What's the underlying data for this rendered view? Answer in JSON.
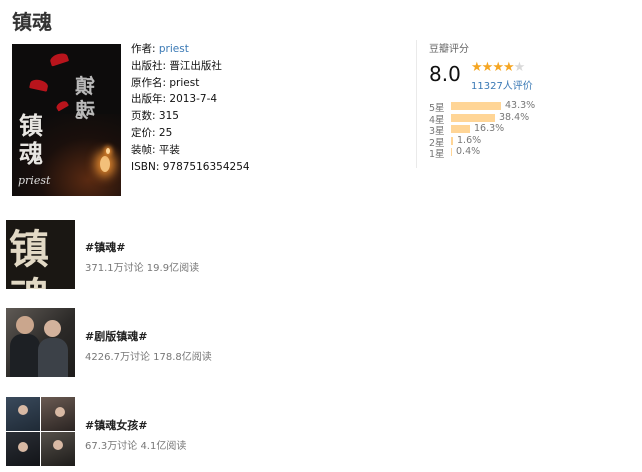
{
  "book": {
    "title": "镇魂",
    "cover": {
      "title_text": "镇魂",
      "mirror_text": "镇魂",
      "author_text": "priest"
    },
    "info": [
      {
        "label": "作者:",
        "value": "priest",
        "is_link": true
      },
      {
        "label": "出版社:",
        "value": "晋江出版社",
        "is_link": false
      },
      {
        "label": "原作名:",
        "value": "priest",
        "is_link": false
      },
      {
        "label": "出版年:",
        "value": "2013-7-4",
        "is_link": false
      },
      {
        "label": "页数:",
        "value": "315",
        "is_link": false
      },
      {
        "label": "定价:",
        "value": "25",
        "is_link": false
      },
      {
        "label": "装帧:",
        "value": "平装",
        "is_link": false
      },
      {
        "label": "ISBN:",
        "value": "9787516354254",
        "is_link": false
      }
    ]
  },
  "rating": {
    "label": "豆瓣评分",
    "score": "8.0",
    "stars_filled": 4,
    "stars_total": 5,
    "count_text": "11327人评价",
    "breakdown": [
      {
        "label": "5星",
        "pct_text": "43.3%",
        "pct": 43.3
      },
      {
        "label": "4星",
        "pct_text": "38.4%",
        "pct": 38.4
      },
      {
        "label": "3星",
        "pct_text": "16.3%",
        "pct": 16.3
      },
      {
        "label": "2星",
        "pct_text": "1.6%",
        "pct": 1.6
      },
      {
        "label": "1星",
        "pct_text": "0.4%",
        "pct": 0.4
      }
    ],
    "colors": {
      "star": "#f5a623",
      "bar": "#ffd596"
    }
  },
  "topics": [
    {
      "title": "#镇魂#",
      "meta": "371.1万讨论 19.9亿阅读",
      "image_text": "镇魂"
    },
    {
      "title": "#剧版镇魂#",
      "meta": "4226.7万讨论 178.8亿阅读"
    },
    {
      "title": "#镇魂女孩#",
      "meta": "67.3万讨论 4.1亿阅读"
    }
  ]
}
